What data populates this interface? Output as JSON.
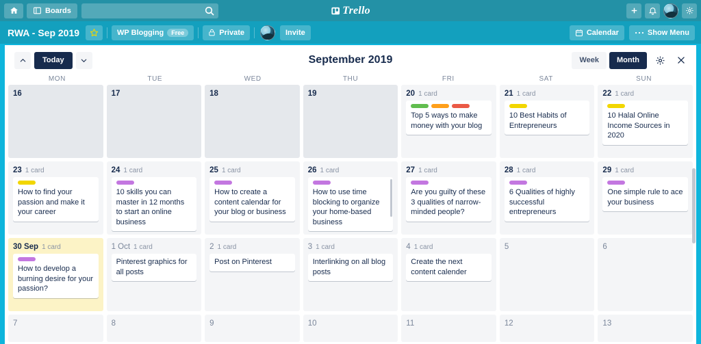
{
  "top_nav": {
    "home_icon": "home-icon",
    "boards_label": "Boards",
    "boards_icon": "board-icon",
    "search_placeholder": "",
    "search_value": "",
    "search_icon": "search-icon",
    "logo_text": "Trello",
    "logo_icon": "trello-board-icon",
    "add_icon": "plus-icon",
    "notifications_icon": "bell-icon",
    "avatar_icon": "user-avatar",
    "settings_icon": "gear-icon"
  },
  "board_bar": {
    "title": "RWA - Sep 2019",
    "star_icon": "star-icon",
    "team_label": "WP Blogging",
    "plan_badge": "Free",
    "visibility_label": "Private",
    "lock_icon": "lock-icon",
    "member_avatar": "member-avatar",
    "invite_label": "Invite",
    "calendar_label": "Calendar",
    "calendar_icon": "calendar-icon",
    "show_menu_label": "Show Menu",
    "show_menu_icon": "ellipsis-icon"
  },
  "calendar": {
    "prev_icon": "chevron-up-icon",
    "next_icon": "chevron-down-icon",
    "today_label": "Today",
    "month_title": "September 2019",
    "week_label": "Week",
    "month_label": "Month",
    "settings_icon": "gear-icon",
    "close_icon": "close-icon",
    "weekdays": [
      "MON",
      "TUE",
      "WED",
      "THU",
      "FRI",
      "SAT",
      "SUN"
    ],
    "colors": {
      "label_green": "#61bd4f",
      "label_yellow": "#f2d600",
      "label_orange": "#ff9f1a",
      "label_red": "#eb5a46",
      "label_purple": "#c377e0",
      "today_bg": "#fcf3c6",
      "accent": "#0eb5dc"
    },
    "weeks": [
      {
        "days": [
          {
            "num": "16",
            "state": "past",
            "count": "",
            "cards": []
          },
          {
            "num": "17",
            "state": "past",
            "count": "",
            "cards": []
          },
          {
            "num": "18",
            "state": "past",
            "count": "",
            "cards": []
          },
          {
            "num": "19",
            "state": "past",
            "count": "",
            "cards": []
          },
          {
            "num": "20",
            "state": "normal",
            "count": "1 card",
            "cards": [
              {
                "title": "Top 5 ways to make money with your blog",
                "labels": [
                  "label_green",
                  "label_orange",
                  "label_red"
                ],
                "scroll": false
              }
            ]
          },
          {
            "num": "21",
            "state": "normal",
            "count": "1 card",
            "cards": [
              {
                "title": "10 Best Habits of Entrepreneurs",
                "labels": [
                  "label_yellow"
                ],
                "scroll": false
              }
            ]
          },
          {
            "num": "22",
            "state": "normal",
            "count": "1 card",
            "cards": [
              {
                "title": "10 Halal Online Income Sources in 2020",
                "labels": [
                  "label_yellow"
                ],
                "scroll": false
              }
            ]
          }
        ]
      },
      {
        "days": [
          {
            "num": "23",
            "state": "normal",
            "count": "1 card",
            "cards": [
              {
                "title": "How to find your passion and make it your career",
                "labels": [
                  "label_yellow"
                ],
                "scroll": false
              }
            ]
          },
          {
            "num": "24",
            "state": "normal",
            "count": "1 card",
            "cards": [
              {
                "title": "10 skills you can master in 12 months to start an online business",
                "labels": [
                  "label_purple"
                ],
                "scroll": false
              }
            ]
          },
          {
            "num": "25",
            "state": "normal",
            "count": "1 card",
            "cards": [
              {
                "title": "How to create a content calendar for your blog or business",
                "labels": [
                  "label_purple"
                ],
                "scroll": false
              }
            ]
          },
          {
            "num": "26",
            "state": "normal",
            "count": "1 card",
            "cards": [
              {
                "title": "How to use time blocking to organize your home-based business",
                "labels": [
                  "label_purple"
                ],
                "scroll": true
              }
            ]
          },
          {
            "num": "27",
            "state": "normal",
            "count": "1 card",
            "cards": [
              {
                "title": "Are you guilty of these 3 qualities of narrow-minded people?",
                "labels": [
                  "label_purple"
                ],
                "scroll": false
              }
            ]
          },
          {
            "num": "28",
            "state": "normal",
            "count": "1 card",
            "cards": [
              {
                "title": "6 Qualities of highly successful entrepreneurs",
                "labels": [
                  "label_purple"
                ],
                "scroll": false
              }
            ]
          },
          {
            "num": "29",
            "state": "normal",
            "count": "1 card",
            "cards": [
              {
                "title": "One simple rule to ace your business",
                "labels": [
                  "label_purple"
                ],
                "scroll": false
              }
            ]
          }
        ]
      },
      {
        "days": [
          {
            "num": "30 Sep",
            "state": "today",
            "count": "1 card",
            "cards": [
              {
                "title": "How to develop a burning desire for your passion?",
                "labels": [
                  "label_purple"
                ],
                "scroll": false
              }
            ]
          },
          {
            "num": "1 Oct",
            "state": "muted",
            "count": "1 card",
            "cards": [
              {
                "title": "Pinterest graphics for all posts",
                "labels": [],
                "scroll": false
              }
            ]
          },
          {
            "num": "2",
            "state": "muted",
            "count": "1 card",
            "cards": [
              {
                "title": "Post on Pinterest",
                "labels": [],
                "scroll": false
              }
            ]
          },
          {
            "num": "3",
            "state": "muted",
            "count": "1 card",
            "cards": [
              {
                "title": "Interlinking on all blog posts",
                "labels": [],
                "scroll": false
              }
            ]
          },
          {
            "num": "4",
            "state": "muted",
            "count": "1 card",
            "cards": [
              {
                "title": "Create the next content calender",
                "labels": [],
                "scroll": false
              }
            ]
          },
          {
            "num": "5",
            "state": "muted",
            "count": "",
            "cards": []
          },
          {
            "num": "6",
            "state": "muted",
            "count": "",
            "cards": []
          }
        ]
      },
      {
        "short": true,
        "days": [
          {
            "num": "7",
            "state": "muted",
            "count": "",
            "cards": []
          },
          {
            "num": "8",
            "state": "muted",
            "count": "",
            "cards": []
          },
          {
            "num": "9",
            "state": "muted",
            "count": "",
            "cards": []
          },
          {
            "num": "10",
            "state": "muted",
            "count": "",
            "cards": []
          },
          {
            "num": "11",
            "state": "muted",
            "count": "",
            "cards": []
          },
          {
            "num": "12",
            "state": "muted",
            "count": "",
            "cards": []
          },
          {
            "num": "13",
            "state": "muted",
            "count": "",
            "cards": []
          }
        ]
      }
    ]
  }
}
